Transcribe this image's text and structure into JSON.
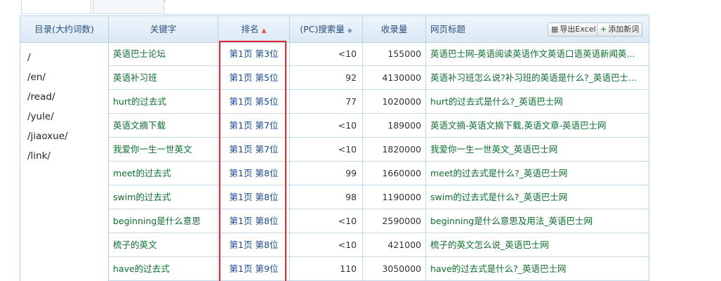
{
  "header": {
    "directory": "目录(大约词数)",
    "keyword": "关键字",
    "rank": "排名",
    "rank_sort_icon": "sort-desc-icon",
    "pc_volume": "(PC)搜索量",
    "pc_sort_icon": "sort-both-icon",
    "indexed": "收录量",
    "page_title": "网页标题",
    "export_label": "导出Excel",
    "add_label": "添加新词"
  },
  "directories": [
    "/",
    "/en/",
    "/read/",
    "/yule/",
    "/jiaoxue/",
    "/link/"
  ],
  "rows": [
    {
      "keyword": "英语巴士论坛",
      "rank": "第1页 第3位",
      "pc": "<10",
      "indexed": "155000",
      "title": "英语巴士网-英语阅读英语作文英语口语英语新闻英..."
    },
    {
      "keyword": "英语补习班",
      "rank": "第1页 第5位",
      "pc": "92",
      "indexed": "4130000",
      "title": "英语补习班怎么说?补习班的英语是什么?_英语巴士..."
    },
    {
      "keyword": "hurt的过去式",
      "rank": "第1页 第5位",
      "pc": "77",
      "indexed": "1020000",
      "title": "hurt的过去式是什么?_英语巴士网"
    },
    {
      "keyword": "英语文摘下载",
      "rank": "第1页 第7位",
      "pc": "<10",
      "indexed": "189000",
      "title": "英语文摘-英语文摘下载,英语文章-英语巴士网"
    },
    {
      "keyword": "我爱你一生一世英文",
      "rank": "第1页 第7位",
      "pc": "<10",
      "indexed": "1820000",
      "title": "我爱你一生一世英文_英语巴士网"
    },
    {
      "keyword": "meet的过去式",
      "rank": "第1页 第8位",
      "pc": "99",
      "indexed": "1660000",
      "title": "meet的过去式是什么?_英语巴士网"
    },
    {
      "keyword": "swim的过去式",
      "rank": "第1页 第8位",
      "pc": "98",
      "indexed": "1190000",
      "title": "swim的过去式是什么?_英语巴士网"
    },
    {
      "keyword": "beginning是什么意思",
      "rank": "第1页 第8位",
      "pc": "<10",
      "indexed": "2590000",
      "title": "beginning是什么意思及用法_英语巴士网"
    },
    {
      "keyword": "梳子的英文",
      "rank": "第1页 第8位",
      "pc": "<10",
      "indexed": "421000",
      "title": "梳子的英文怎么说_英语巴士网"
    },
    {
      "keyword": "have的过去式",
      "rank": "第1页 第9位",
      "pc": "110",
      "indexed": "3050000",
      "title": "have的过去式是什么?_英语巴士网"
    }
  ],
  "colors": {
    "keyword_text": "#0e6e2e",
    "rank_text": "#1a4a94",
    "header_text": "#2b4f80",
    "highlight_box": "#e0262b",
    "grid_line": "#c6d9e8"
  }
}
